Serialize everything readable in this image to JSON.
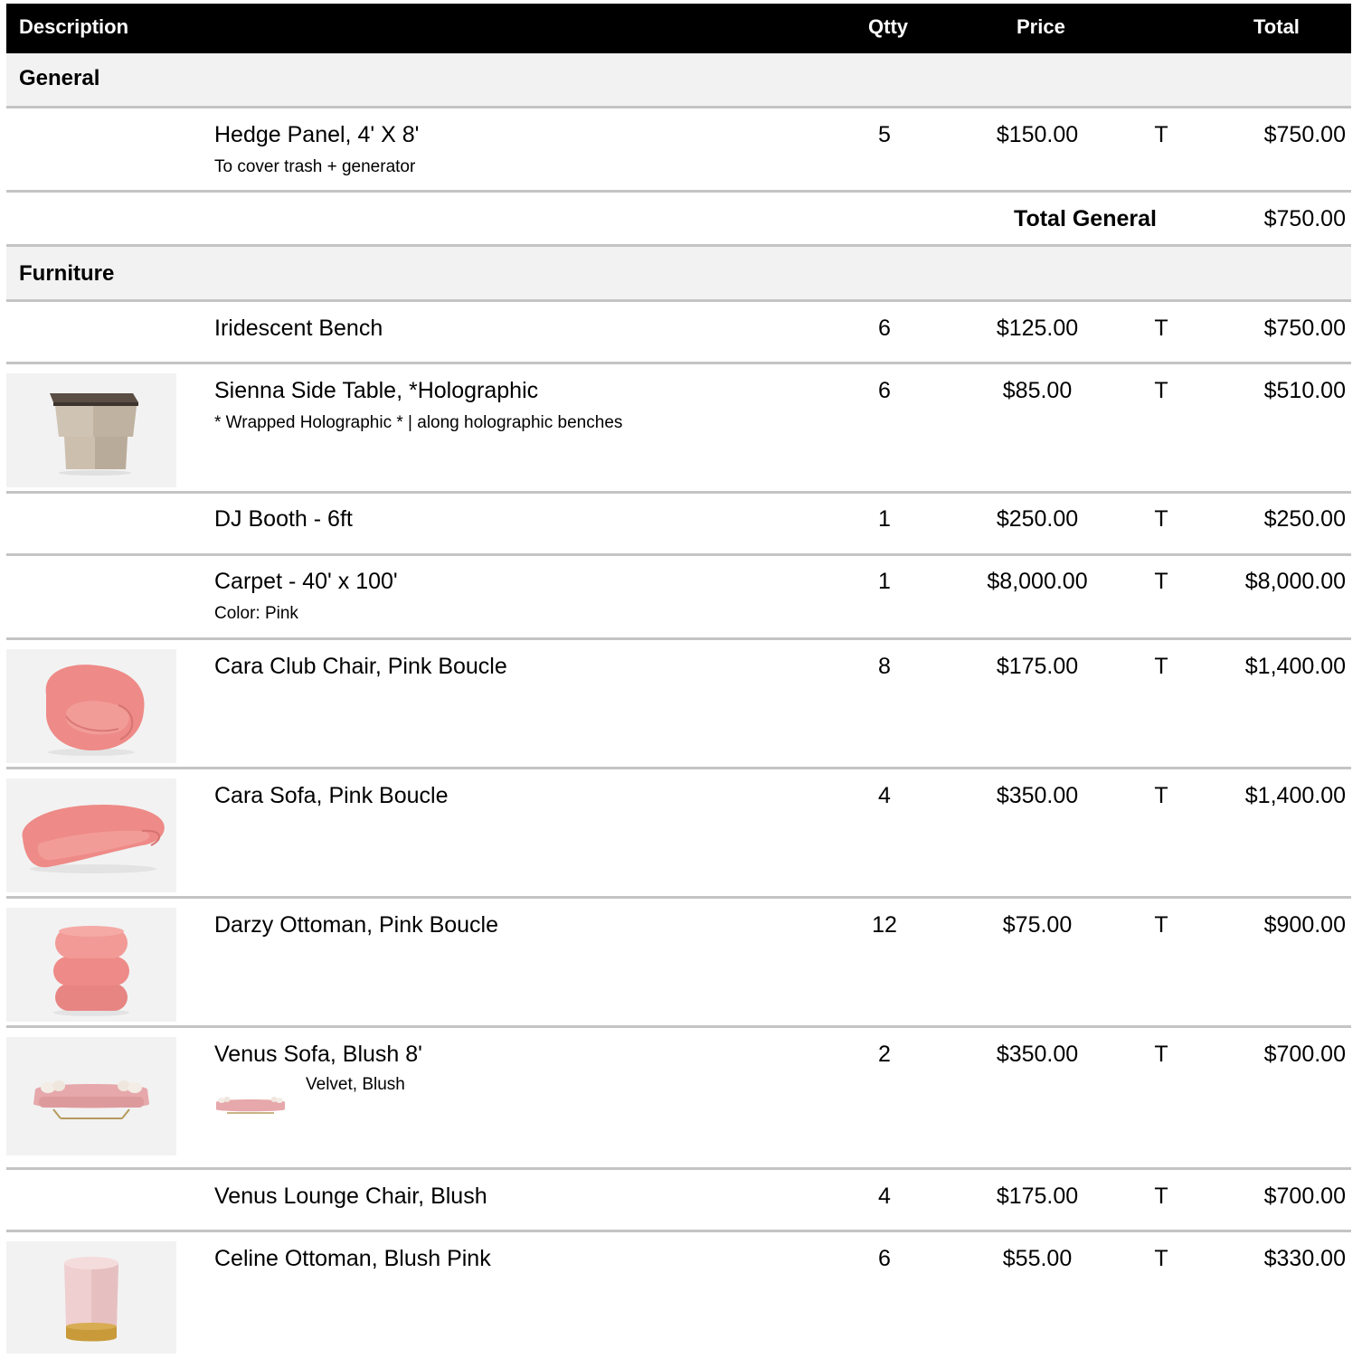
{
  "header": {
    "description": "Description",
    "qty": "Qtty",
    "price": "Price",
    "total": "Total"
  },
  "sections": [
    {
      "name": "General",
      "items": [
        {
          "description": "Hedge Panel, 4' X 8'",
          "note": "To cover trash + generator",
          "qty": "5",
          "price": "$150.00",
          "tax": "T",
          "total": "$750.00",
          "image": "none"
        }
      ],
      "subtotal_label": "Total General",
      "subtotal": "$750.00"
    },
    {
      "name": "Furniture",
      "items": [
        {
          "description": "Iridescent Bench",
          "note": "",
          "qty": "6",
          "price": "$125.00",
          "tax": "T",
          "total": "$750.00",
          "image": "none"
        },
        {
          "description": "Sienna Side Table, *Holographic",
          "note": "* Wrapped Holographic * | along holographic benches",
          "qty": "6",
          "price": "$85.00",
          "tax": "T",
          "total": "$510.00",
          "image": "side-table"
        },
        {
          "description": "DJ Booth - 6ft",
          "note": "",
          "qty": "1",
          "price": "$250.00",
          "tax": "T",
          "total": "$250.00",
          "image": "none"
        },
        {
          "description": "Carpet - 40' x 100'",
          "note": "Color: Pink",
          "qty": "1",
          "price": "$8,000.00",
          "tax": "T",
          "total": "$8,000.00",
          "image": "none"
        },
        {
          "description": "Cara Club Chair, Pink Boucle",
          "note": "",
          "qty": "8",
          "price": "$175.00",
          "tax": "T",
          "total": "$1,400.00",
          "image": "club-chair"
        },
        {
          "description": "Cara Sofa, Pink Boucle",
          "note": "",
          "qty": "4",
          "price": "$350.00",
          "tax": "T",
          "total": "$1,400.00",
          "image": "pink-sofa"
        },
        {
          "description": "Darzy Ottoman, Pink Boucle",
          "note": "",
          "qty": "12",
          "price": "$75.00",
          "tax": "T",
          "total": "$900.00",
          "image": "stacked-ottoman"
        },
        {
          "description": "Venus Sofa, Blush 8'",
          "note": "Velvet, Blush",
          "qty": "2",
          "price": "$350.00",
          "tax": "T",
          "total": "$700.00",
          "image": "blush-sofa"
        },
        {
          "description": "Venus Lounge Chair, Blush",
          "note": "",
          "qty": "4",
          "price": "$175.00",
          "tax": "T",
          "total": "$700.00",
          "image": "none"
        },
        {
          "description": "Celine Ottoman, Blush Pink",
          "note": "",
          "qty": "6",
          "price": "$55.00",
          "tax": "T",
          "total": "$330.00",
          "image": "round-ottoman"
        }
      ]
    }
  ],
  "colors": {
    "header_bg": "#000000",
    "section_bg": "#f2f2f2",
    "divider": "#c4c4c4",
    "boucle_pink": "#ee8a87",
    "blush": "#e6a8ab"
  }
}
